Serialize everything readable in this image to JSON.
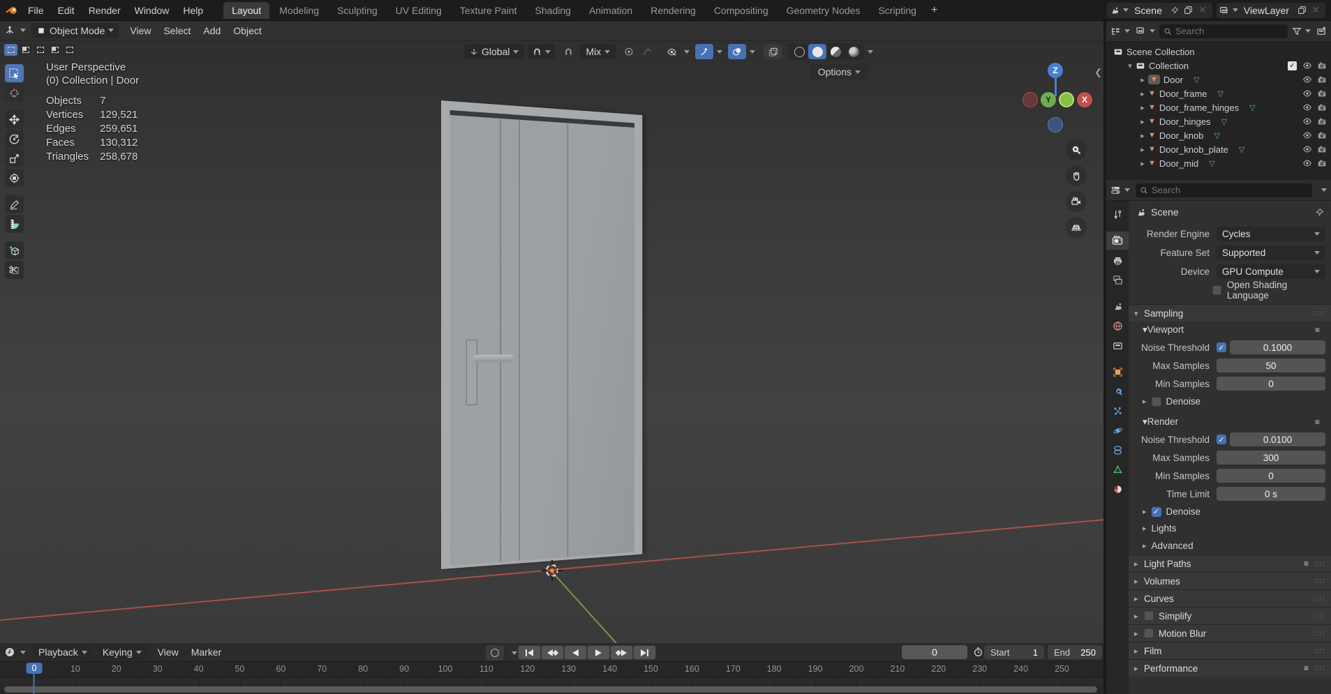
{
  "colors": {
    "accent": "#4772b3",
    "selection_blue": "#4f76b8",
    "mesh_orange": "#e8935c",
    "data_green": "#54c27c",
    "axis_red": "#ba5450",
    "axis_green": "#71a652"
  },
  "topbar": {
    "menus": [
      "File",
      "Edit",
      "Render",
      "Window",
      "Help"
    ],
    "workspaces": [
      "Layout",
      "Modeling",
      "Sculpting",
      "UV Editing",
      "Texture Paint",
      "Shading",
      "Animation",
      "Rendering",
      "Compositing",
      "Geometry Nodes",
      "Scripting"
    ],
    "active_workspace": "Layout",
    "add_workspace_label": "+",
    "scene_value": "Scene",
    "view_layer_value": "ViewLayer"
  },
  "viewport_header": {
    "mode": "Object Mode",
    "menus": [
      "View",
      "Select",
      "Add",
      "Object"
    ],
    "orientation": "Global",
    "snap_mode": "Mix",
    "options_label": "Options",
    "select_modes": [
      "set",
      "extend",
      "subtract",
      "invert",
      "intersect"
    ],
    "shading_modes": [
      "wireframe",
      "solid",
      "material-preview",
      "rendered"
    ],
    "active_shading": "solid"
  },
  "toolbar": {
    "tools": [
      "select-box",
      "cursor",
      "move",
      "rotate",
      "scale",
      "transform",
      "annotate",
      "measure",
      "add-cube",
      "cut"
    ],
    "active_tool": "select-box"
  },
  "viewport_overlay": {
    "view_name": "User Perspective",
    "context_path": "(0) Collection | Door",
    "stats": [
      {
        "label": "Objects",
        "value": "7"
      },
      {
        "label": "Vertices",
        "value": "129,521"
      },
      {
        "label": "Edges",
        "value": "259,651"
      },
      {
        "label": "Faces",
        "value": "130,312"
      },
      {
        "label": "Triangles",
        "value": "258,678"
      }
    ]
  },
  "gizmo": {
    "axis_labels": [
      "Z",
      "Y",
      "X"
    ]
  },
  "outliner": {
    "search_placeholder": "Search",
    "root_collection": "Scene Collection",
    "collection": "Collection",
    "objects": [
      "Door",
      "Door_frame",
      "Door_frame_hinges",
      "Door_hinges",
      "Door_knob",
      "Door_knob_plate",
      "Door_mid"
    ],
    "selected_object": "Door"
  },
  "properties": {
    "search_placeholder": "Search",
    "breadcrumb": "Scene",
    "fields": [
      {
        "label": "Render Engine",
        "value": "Cycles"
      },
      {
        "label": "Feature Set",
        "value": "Supported"
      },
      {
        "label": "Device",
        "value": "GPU Compute"
      }
    ],
    "osl": {
      "label": "Open Shading Language",
      "checked": false
    },
    "sampling": {
      "title": "Sampling",
      "viewport": {
        "title": "Viewport",
        "noise_threshold": {
          "label": "Noise Threshold",
          "checked": true,
          "value": "0.1000"
        },
        "rows": [
          {
            "label": "Max Samples",
            "value": "50"
          },
          {
            "label": "Min Samples",
            "value": "0"
          }
        ],
        "denoise": {
          "label": "Denoise",
          "checked": false
        }
      },
      "render": {
        "title": "Render",
        "noise_threshold": {
          "label": "Noise Threshold",
          "checked": true,
          "value": "0.0100"
        },
        "rows": [
          {
            "label": "Max Samples",
            "value": "300"
          },
          {
            "label": "Min Samples",
            "value": "0"
          },
          {
            "label": "Time Limit",
            "value": "0 s"
          }
        ],
        "denoise": {
          "label": "Denoise",
          "checked": true
        }
      },
      "subpanels": [
        "Lights",
        "Advanced"
      ]
    },
    "collapsed_panels": [
      {
        "label": "Light Paths",
        "preset": true
      },
      {
        "label": "Volumes"
      },
      {
        "label": "Curves"
      },
      {
        "label": "Simplify",
        "checkbox": true
      },
      {
        "label": "Motion Blur",
        "checkbox": true
      },
      {
        "label": "Film"
      },
      {
        "label": "Performance",
        "preset": true
      }
    ],
    "tabs": [
      "tool",
      "render",
      "output",
      "view-layer",
      "scene",
      "world",
      "collection",
      "object",
      "modifiers",
      "particles",
      "physics",
      "constraints",
      "object-data",
      "material"
    ],
    "active_tab": "render"
  },
  "timeline": {
    "menus": [
      "Playback",
      "Keying",
      "View",
      "Marker"
    ],
    "current_frame": "0",
    "start_label": "Start",
    "start_value": "1",
    "end_label": "End",
    "end_value": "250",
    "ruler": {
      "min": 0,
      "max": 250,
      "step": 10
    },
    "playhead_frame": "0"
  }
}
